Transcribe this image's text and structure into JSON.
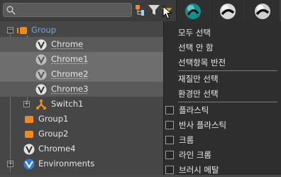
{
  "search": {
    "placeholder": ""
  },
  "tree": {
    "rows": [
      {
        "label": "Group",
        "icon": "group-icon"
      },
      {
        "label": "Chrome",
        "icon": "material-v-icon"
      },
      {
        "label": "Chrome1",
        "icon": "material-v-icon"
      },
      {
        "label": "Chrome2",
        "icon": "material-v-icon"
      },
      {
        "label": "Chrome3",
        "icon": "material-v-icon"
      },
      {
        "label": "Switch1",
        "icon": "switch-icon"
      },
      {
        "label": "Group1",
        "icon": "group-icon"
      },
      {
        "label": "Group2",
        "icon": "group-icon"
      },
      {
        "label": "Chrome4",
        "icon": "material-v-icon"
      },
      {
        "label": "Environments",
        "icon": "environment-icon"
      }
    ]
  },
  "menu": {
    "items": [
      {
        "label": "모두 선택"
      },
      {
        "label": "선택 안 함"
      },
      {
        "label": "선택항목 반전"
      },
      {
        "label": "재질만 선택"
      },
      {
        "label": "환경만 선택"
      },
      {
        "label": "플라스틱",
        "checked": false
      },
      {
        "label": "반사 플라스틱",
        "checked": false
      },
      {
        "label": "크롬",
        "checked": false
      },
      {
        "label": "라인 크롬",
        "checked": false
      },
      {
        "label": "브러시 메탈",
        "checked": false
      }
    ]
  },
  "colors": {
    "accent_blue": "#6fa6e6",
    "group_orange": "#f08a1a",
    "filter_yellow": "#e0b020",
    "teal_ball": "#1aa7a0"
  }
}
